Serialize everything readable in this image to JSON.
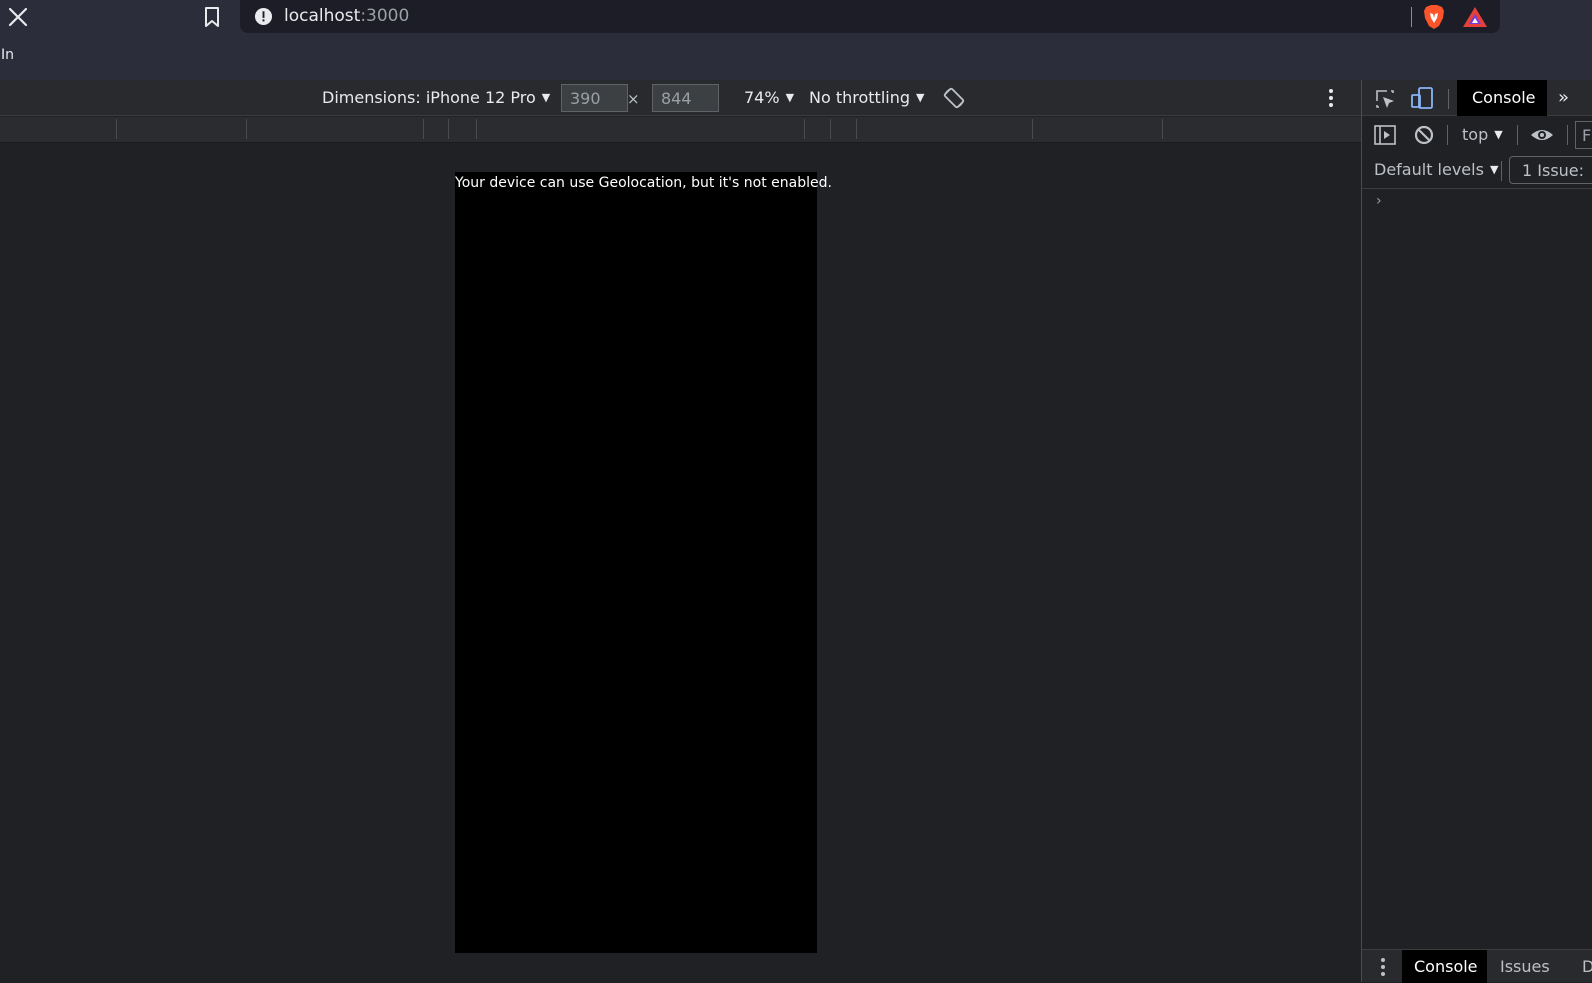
{
  "browser": {
    "url_host": "localhost",
    "url_port": ":3000",
    "partial_text": "In"
  },
  "device_toolbar": {
    "dimensions_label": "Dimensions: iPhone 12 Pro",
    "width": "390",
    "height": "844",
    "times": "×",
    "zoom": "74%",
    "throttling": "No throttling"
  },
  "page": {
    "message": "Your device can use Geolocation, but it's not enabled."
  },
  "devtools": {
    "top_tab_console": "Console",
    "more_tabs": "»",
    "context": "top",
    "filter_placeholder": "F",
    "levels": "Default levels",
    "issues": "1 Issue:",
    "prompt": "›",
    "drawer_tabs": [
      "Console",
      "Issues",
      "D"
    ]
  },
  "colors": {
    "chrome_bg": "#2b2d3a",
    "toolbar_bg": "#292a2d",
    "panel_bg": "#202124",
    "device_screen": "#000000",
    "brave_orange": "#fb542b"
  },
  "icons": {
    "close": "close-icon",
    "bookmark": "bookmark-icon",
    "info": "info-icon",
    "brave": "brave-lion-icon",
    "rewards": "brave-rewards-icon",
    "rotate": "rotate-icon",
    "more": "more-vertical-icon",
    "inspect": "inspect-element-icon",
    "device": "device-toggle-icon",
    "sidebar": "sidebar-toggle-icon",
    "clear": "clear-console-icon",
    "eye": "live-expression-eye-icon"
  }
}
